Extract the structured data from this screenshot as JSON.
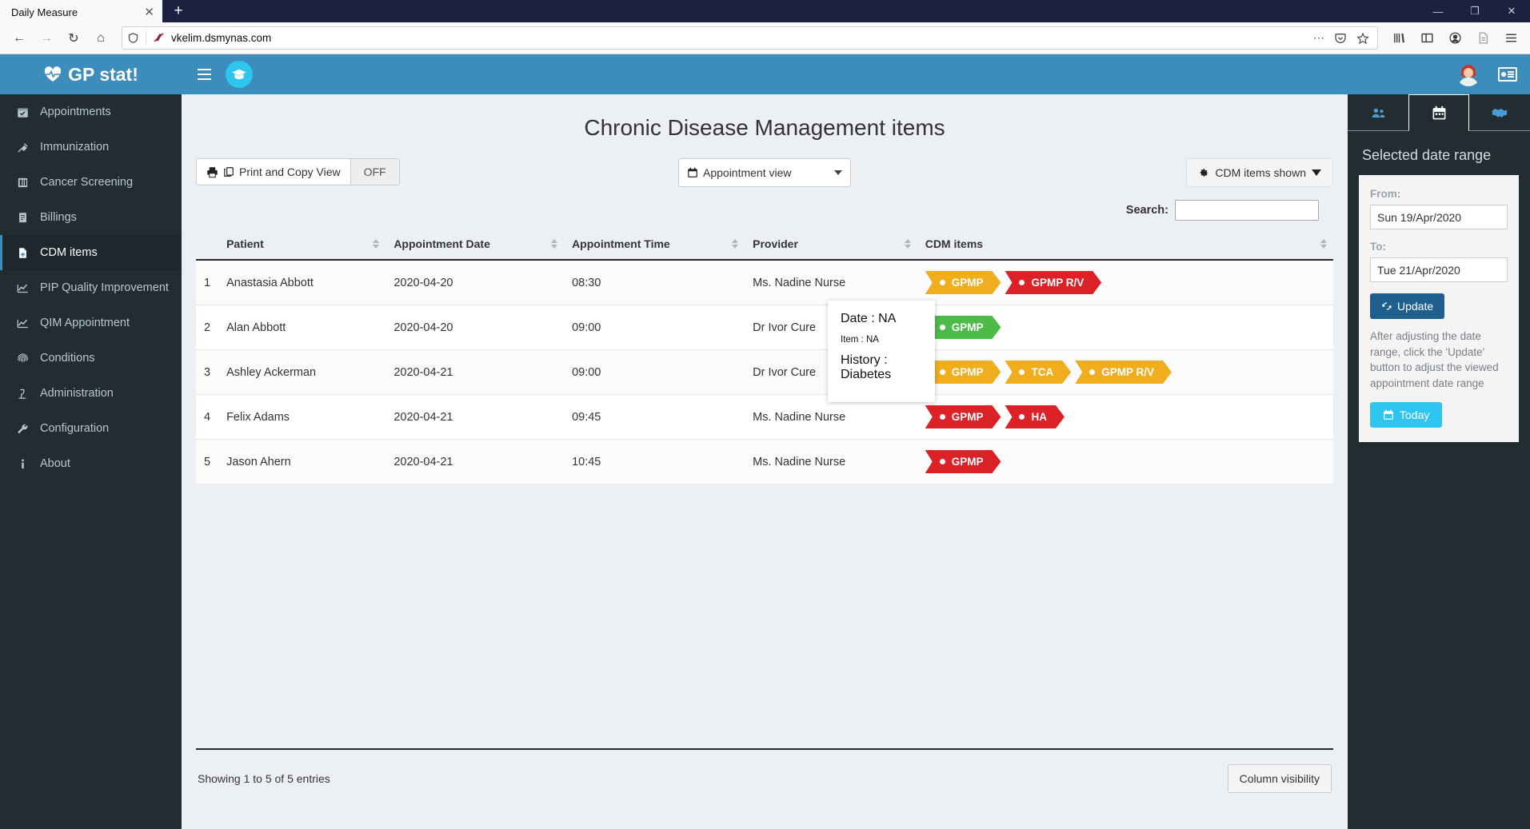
{
  "browser": {
    "tab_title": "Daily Measure",
    "close_glyph": "✕",
    "newtab_glyph": "+",
    "url": "vkelim.dsmynas.com",
    "back_glyph": "←",
    "forward_glyph": "→",
    "reload_glyph": "↻",
    "home_glyph": "⌂",
    "ellipsis_glyph": "⋯",
    "minimize_glyph": "—",
    "maximize_glyph": "❐",
    "close_win_glyph": "✕"
  },
  "sidebar": {
    "brand": "GP stat!",
    "brand_icon": "heartbeat-icon",
    "items": [
      {
        "label": "Appointments",
        "icon": "calendar-check-icon",
        "active": false
      },
      {
        "label": "Immunization",
        "icon": "syringe-icon",
        "active": false
      },
      {
        "label": "Cancer Screening",
        "icon": "ribbon-icon",
        "active": false
      },
      {
        "label": "Billings",
        "icon": "receipt-icon",
        "active": false
      },
      {
        "label": "CDM items",
        "icon": "file-medical-icon",
        "active": true
      },
      {
        "label": "PIP Quality Improvement",
        "icon": "chart-line-icon",
        "active": false
      },
      {
        "label": "QIM Appointment",
        "icon": "chart-line-icon",
        "active": false
      },
      {
        "label": "Conditions",
        "icon": "fingerprint-icon",
        "active": false
      },
      {
        "label": "Administration",
        "icon": "microscope-icon",
        "active": false
      },
      {
        "label": "Configuration",
        "icon": "wrench-icon",
        "active": false
      },
      {
        "label": "About",
        "icon": "info-icon",
        "active": false
      }
    ]
  },
  "appbar": {
    "logo_icon": "graduation-cap-icon",
    "accent_color": "#3c8dbc",
    "logo_bg": "#2ec6ef"
  },
  "main": {
    "title": "Chronic Disease Management items",
    "print_copy_label": "Print and Copy View",
    "print_copy_state": "OFF",
    "view_select_value": "Appointment view",
    "cdm_items_shown_label": "CDM items shown",
    "search_label": "Search:",
    "search_value": "",
    "search_placeholder": "",
    "columns": [
      "",
      "Patient",
      "Appointment Date",
      "Appointment Time",
      "Provider",
      "CDM items"
    ],
    "rows": [
      {
        "num": "1",
        "patient": "Anastasia Abbott",
        "date": "2020-04-20",
        "time": "08:30",
        "provider": "Ms. Nadine Nurse",
        "badges": [
          {
            "label": "GPMP",
            "color": "#f0ad1e"
          },
          {
            "label": "GPMP R/V",
            "color": "#dc2127"
          }
        ]
      },
      {
        "num": "2",
        "patient": "Alan Abbott",
        "date": "2020-04-20",
        "time": "09:00",
        "provider": "Dr Ivor Cure",
        "badges": [
          {
            "label": "GPMP",
            "color": "#4cbb47"
          }
        ]
      },
      {
        "num": "3",
        "patient": "Ashley Ackerman",
        "date": "2020-04-21",
        "time": "09:00",
        "provider": "Dr Ivor Cure",
        "badges": [
          {
            "label": "GPMP",
            "color": "#f0ad1e"
          },
          {
            "label": "TCA",
            "color": "#f0ad1e"
          },
          {
            "label": "GPMP R/V",
            "color": "#f0ad1e"
          }
        ]
      },
      {
        "num": "4",
        "patient": "Felix Adams",
        "date": "2020-04-21",
        "time": "09:45",
        "provider": "Ms. Nadine Nurse",
        "badges": [
          {
            "label": "GPMP",
            "color": "#dc2127"
          },
          {
            "label": "HA",
            "color": "#dc2127"
          }
        ]
      },
      {
        "num": "5",
        "patient": "Jason Ahern",
        "date": "2020-04-21",
        "time": "10:45",
        "provider": "Ms. Nadine Nurse",
        "badges": [
          {
            "label": "GPMP",
            "color": "#dc2127"
          }
        ]
      }
    ],
    "tooltip": {
      "date_line": "Date : NA",
      "item_line": "Item : NA",
      "history_line": "History : Diabetes"
    },
    "showing_text": "Showing 1 to 5 of 5 entries",
    "column_visibility_label": "Column visibility"
  },
  "right_panel": {
    "tabs": [
      {
        "icon": "users-icon",
        "active": false
      },
      {
        "icon": "calendar-icon",
        "active": true
      },
      {
        "icon": "handshake-icon",
        "active": false
      }
    ],
    "title": "Selected date range",
    "from_label": "From:",
    "from_value": "Sun 19/Apr/2020",
    "to_label": "To:",
    "to_value": "Tue 21/Apr/2020",
    "update_label": "Update",
    "help_text": "After adjusting the date range, click the 'Update' button to adjust the viewed appointment date range",
    "today_label": "Today"
  }
}
